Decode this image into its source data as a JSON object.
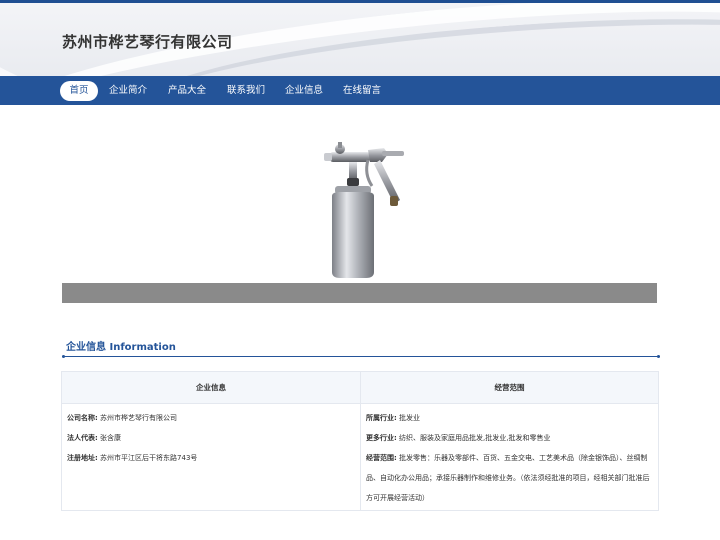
{
  "site": {
    "title": "苏州市桦艺琴行有限公司"
  },
  "nav": {
    "items": [
      {
        "label": "首页",
        "active": true
      },
      {
        "label": "企业简介",
        "active": false
      },
      {
        "label": "产品大全",
        "active": false
      },
      {
        "label": "联系我们",
        "active": false
      },
      {
        "label": "企业信息",
        "active": false
      },
      {
        "label": "在线留言",
        "active": false
      }
    ]
  },
  "banner": {
    "image": "spray-gun-icon"
  },
  "section": {
    "title": "企业信息 Information"
  },
  "table": {
    "left_head": "企业信息",
    "right_head": "经营范围",
    "company_name_label": "公司名称:",
    "company_name": "苏州市桦艺琴行有限公司",
    "legal_rep_label": "法人代表:",
    "legal_rep": "张含康",
    "address_label": "注册地址:",
    "address": "苏州市平江区后干将东路743号",
    "industry_label": "所属行业:",
    "industry": "批发业",
    "more_industry_label": "更多行业:",
    "more_industry": "纺织、服装及家庭用品批发,批发业,批发和零售业",
    "scope_label": "经营范围:",
    "scope": "批发零售：乐器及零部件、百货、五金交电、工艺美术品（除金银饰品）、丝绸制品、自动化办公用品；承接乐器制作和维修业务。（依法须经批准的项目，经相关部门批准后方可开展经营活动）"
  }
}
